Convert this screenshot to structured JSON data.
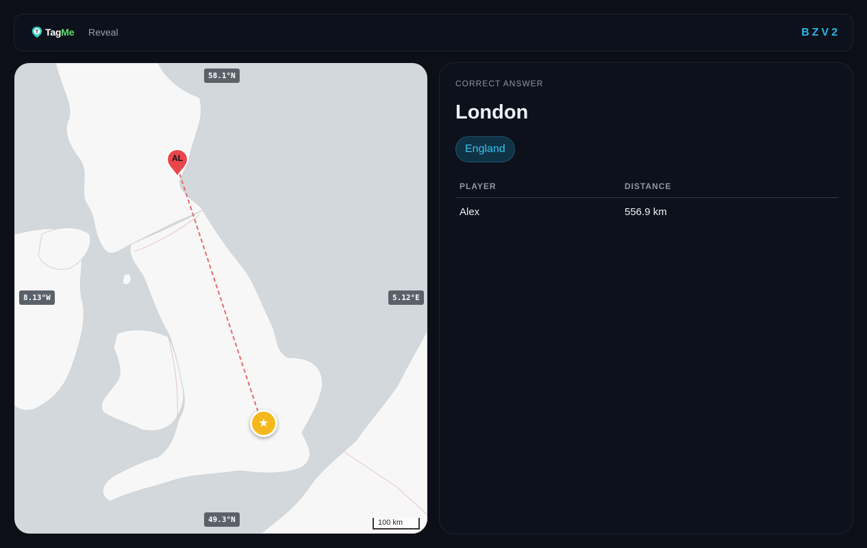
{
  "header": {
    "logo_tag": "Tag",
    "logo_me": "Me",
    "nav_label": "Reveal",
    "room_code": "BZV2"
  },
  "map": {
    "lat_top": "58.1°N",
    "lat_bottom": "49.3°N",
    "lon_left": "8.13°W",
    "lon_right": "5.12°E",
    "scale_label": "100 km",
    "guess_marker_label": "AL",
    "answer_marker_icon": "star-icon",
    "line_color": "#e46a6a",
    "guess_color": "#e8464b",
    "answer_color": "#f5b81c"
  },
  "result": {
    "correct_label": "CORRECT ANSWER",
    "answer": "London",
    "region": "England",
    "columns": [
      "PLAYER",
      "DISTANCE"
    ],
    "rows": [
      {
        "player": "Alex",
        "distance": "556.9 km"
      }
    ]
  },
  "colors": {
    "accent": "#2bb7e8",
    "logo_green": "#5ee06b",
    "background": "#0c0f17"
  }
}
